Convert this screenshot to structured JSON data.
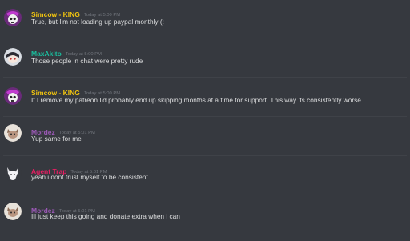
{
  "messages": [
    {
      "author": "Simcow - KING",
      "timestamp": "Today at 5:00 PM",
      "text": "True, but I'm not loading up paypal monthly (:",
      "color": "#f1c40f",
      "avatar": "skull-avatar"
    },
    {
      "author": "MaxAkito",
      "timestamp": "Today at 5:00 PM",
      "text": "Those people in chat were pretty rude",
      "color": "#1abc9c",
      "avatar": "anime-avatar"
    },
    {
      "author": "Simcow - KING",
      "timestamp": "Today at 5:00 PM",
      "text": "If I remove my patreon I'd probably end up skipping months at a time for support. This way its consistently worse.",
      "color": "#f1c40f",
      "avatar": "skull-avatar"
    },
    {
      "author": "Mordez",
      "timestamp": "Today at 5:01 PM",
      "text": "Yup same for me",
      "color": "#9b59b6",
      "avatar": "cat-avatar"
    },
    {
      "author": "Agent Trap",
      "timestamp": "Today at 5:01 PM",
      "text": "yeah i dont trust myself to be consistent",
      "color": "#e91e63",
      "avatar": "wolf-avatar"
    },
    {
      "author": "Mordez",
      "timestamp": "Today at 5:01 PM",
      "text": "Ill just keep this going and donate extra when i can",
      "color": "#9b59b6",
      "avatar": "cat-avatar"
    }
  ]
}
